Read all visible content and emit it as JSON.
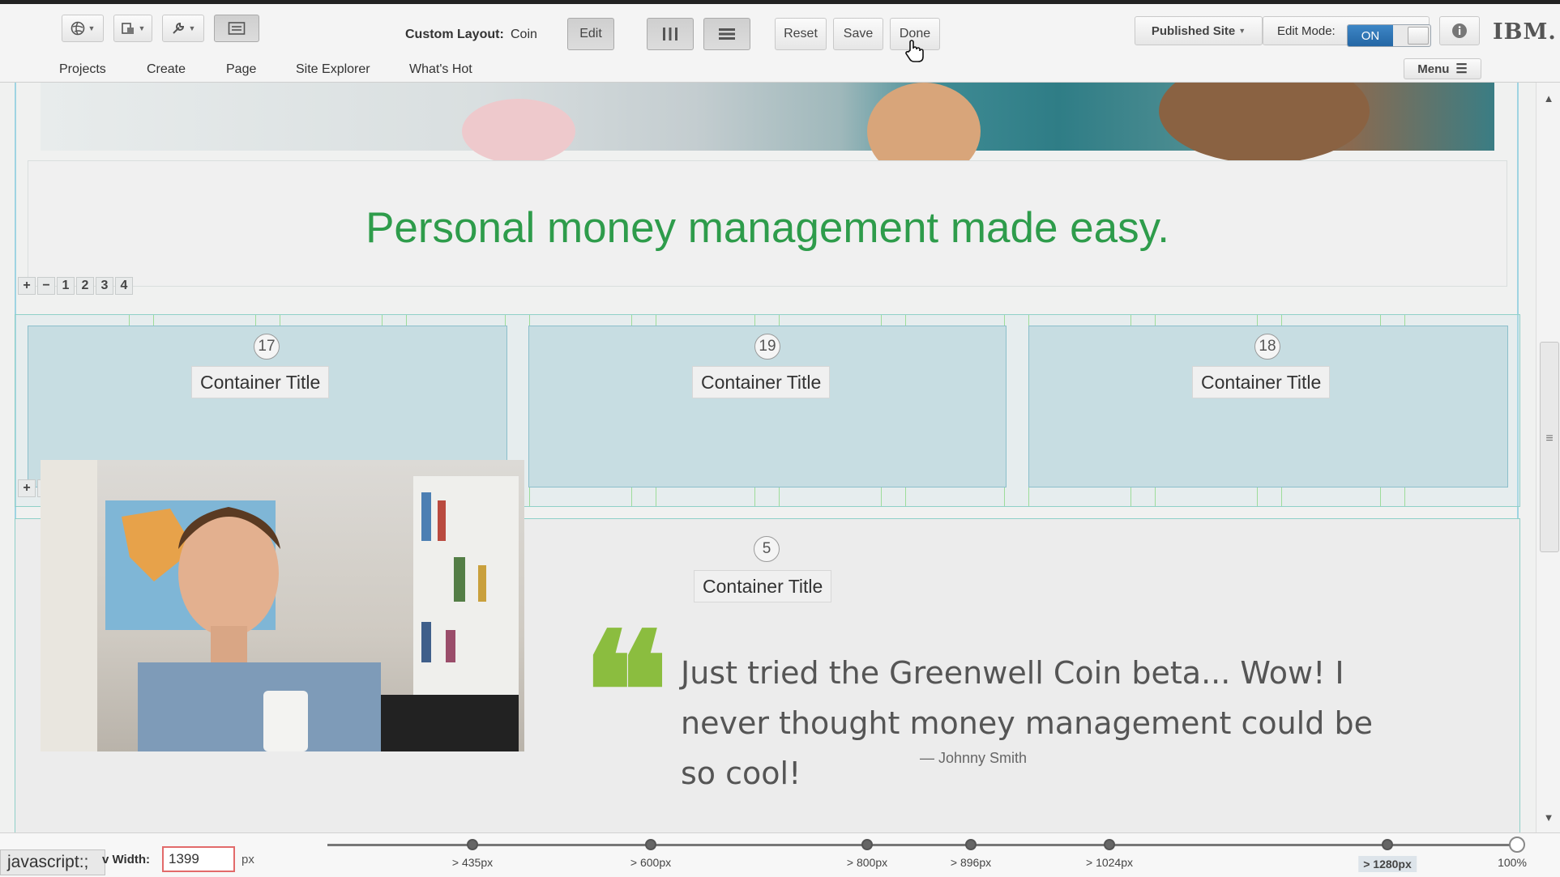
{
  "toolbar": {
    "custom_layout_label": "Custom Layout:",
    "custom_layout_value": "Coin",
    "edit_label": "Edit",
    "reset_label": "Reset",
    "save_label": "Save",
    "done_label": "Done",
    "published_site_label": "Published Site",
    "edit_mode_label": "Edit Mode:",
    "edit_mode_value": "ON",
    "brand": "IBM.",
    "menu_label": "Menu"
  },
  "nav": {
    "items": [
      "Projects",
      "Create",
      "Page",
      "Site Explorer",
      "What's Hot"
    ]
  },
  "content": {
    "headline": "Personal money management made easy.",
    "row_controls": [
      "+",
      "−",
      "1",
      "2",
      "3",
      "4"
    ],
    "containers": [
      {
        "number": "17",
        "title": "Container Title"
      },
      {
        "number": "19",
        "title": "Container Title"
      },
      {
        "number": "18",
        "title": "Container Title"
      }
    ],
    "testimonial": {
      "number": "5",
      "title": "Container Title",
      "quote_mark": "❝",
      "quote": "Just tried the Greenwell Coin beta... Wow! I never thought money management could be so cool!",
      "author": "— Johnny Smith"
    }
  },
  "bottom": {
    "status_text": "javascript:;",
    "viewport_width_label": "v Width:",
    "viewport_width_value": "1399",
    "unit": "px",
    "breakpoints": [
      "> 435px",
      "> 600px",
      "> 800px",
      "> 896px",
      "> 1024px",
      "> 1280px",
      "100%"
    ],
    "active_breakpoint": "> 1280px"
  },
  "colors": {
    "headline_green": "#2e9c4b",
    "quote_green": "#8bbd3f",
    "toggle_blue": "#2f77b8",
    "container_fill": "#c7dde2"
  }
}
